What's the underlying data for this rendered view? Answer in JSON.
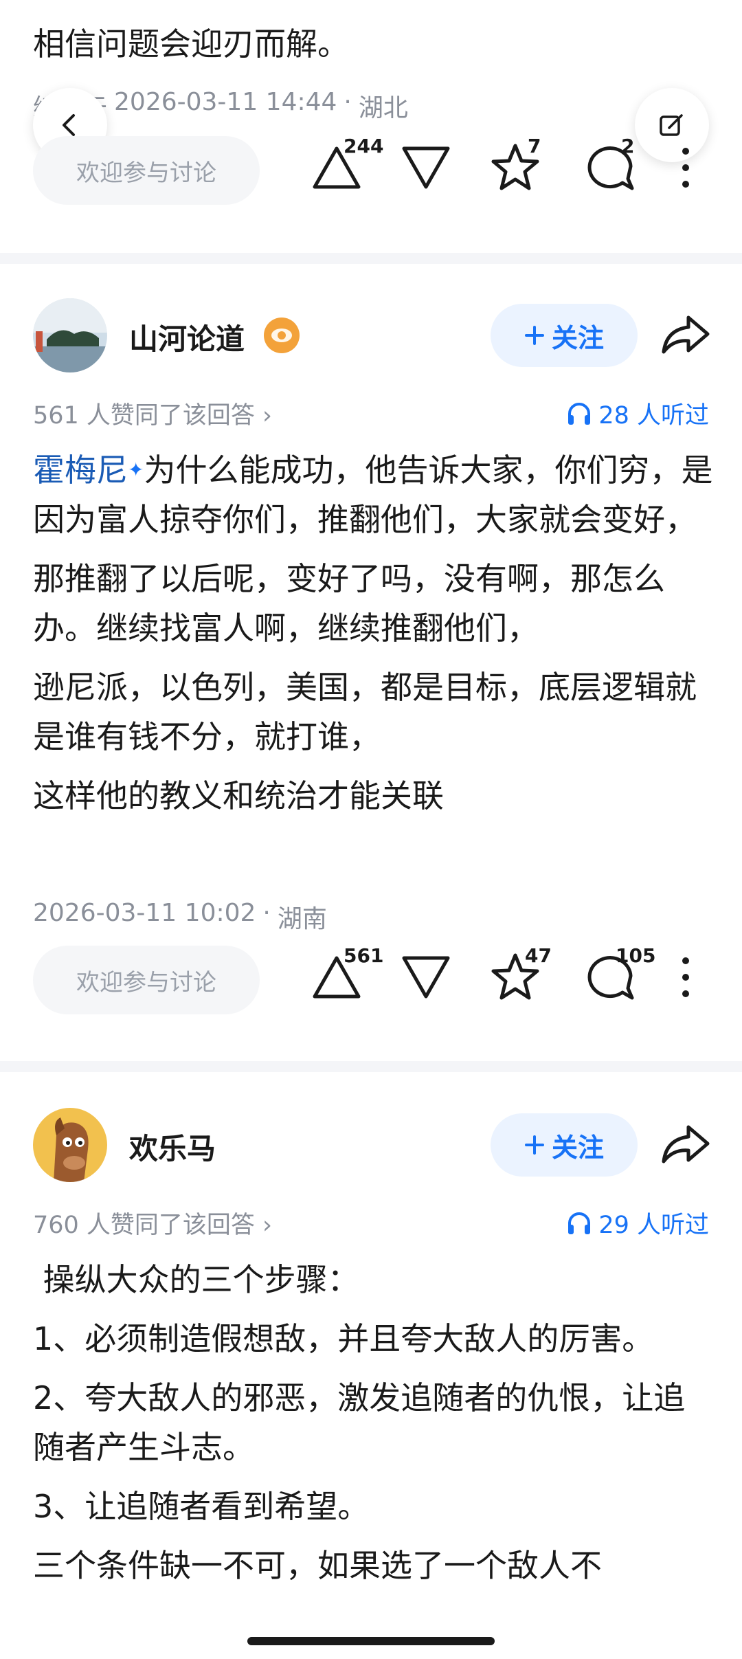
{
  "answer1": {
    "text_tail": "相信问题会迎刃而解。",
    "meta_prefix": "编辑于",
    "meta_date": "2026-03-11 14:44",
    "meta_sep": "·",
    "meta_location": "湖北",
    "discuss_placeholder": "欢迎参与讨论",
    "upvotes": "244",
    "favorites": "7",
    "comments": "2"
  },
  "answer2": {
    "author": "山河论道",
    "follow_label": "关注",
    "agree_text": "561 人赞同了该回答 ›",
    "listen_text": "28 人听过",
    "link_text": "霍梅尼",
    "paragraphs": [
      "为什么能成功，他告诉大家，你们穷，是因为富人掠夺你们，推翻他们，大家就会变好，",
      "那推翻了以后呢，变好了吗，没有啊，那怎么办。继续找富人啊，继续推翻他们，",
      "逊尼派，以色列，美国，都是目标，底层逻辑就是谁有钱不分，就打谁，",
      "这样他的教义和统治才能关联"
    ],
    "meta_date": "2026-03-11 10:02",
    "meta_sep": "·",
    "meta_location": "湖南",
    "discuss_placeholder": "欢迎参与讨论",
    "upvotes": "561",
    "favorites": "47",
    "comments": "105"
  },
  "answer3": {
    "author": "欢乐马",
    "follow_label": "关注",
    "agree_text": "760 人赞同了该回答 ›",
    "listen_text": "29 人听过",
    "paragraphs": [
      " 操纵大众的三个步骤：",
      "1、必须制造假想敌，并且夸大敌人的厉害。",
      "2、夸大敌人的邪恶，激发追随者的仇恨，让追随者产生斗志。",
      "3、让追随者看到希望。",
      "三个条件缺一不可，如果选了一个敌人不"
    ]
  },
  "colors": {
    "accent": "#1772f6",
    "follow_bg": "#ebf3ff",
    "meta_gray": "#8a8f99",
    "divider": "#f4f5f8"
  },
  "icons": [
    "back-icon",
    "edit-icon",
    "upvote-icon",
    "downvote-icon",
    "star-icon",
    "comment-icon",
    "more-icon",
    "share-icon",
    "headphone-icon",
    "plus-icon",
    "badge-icon"
  ]
}
